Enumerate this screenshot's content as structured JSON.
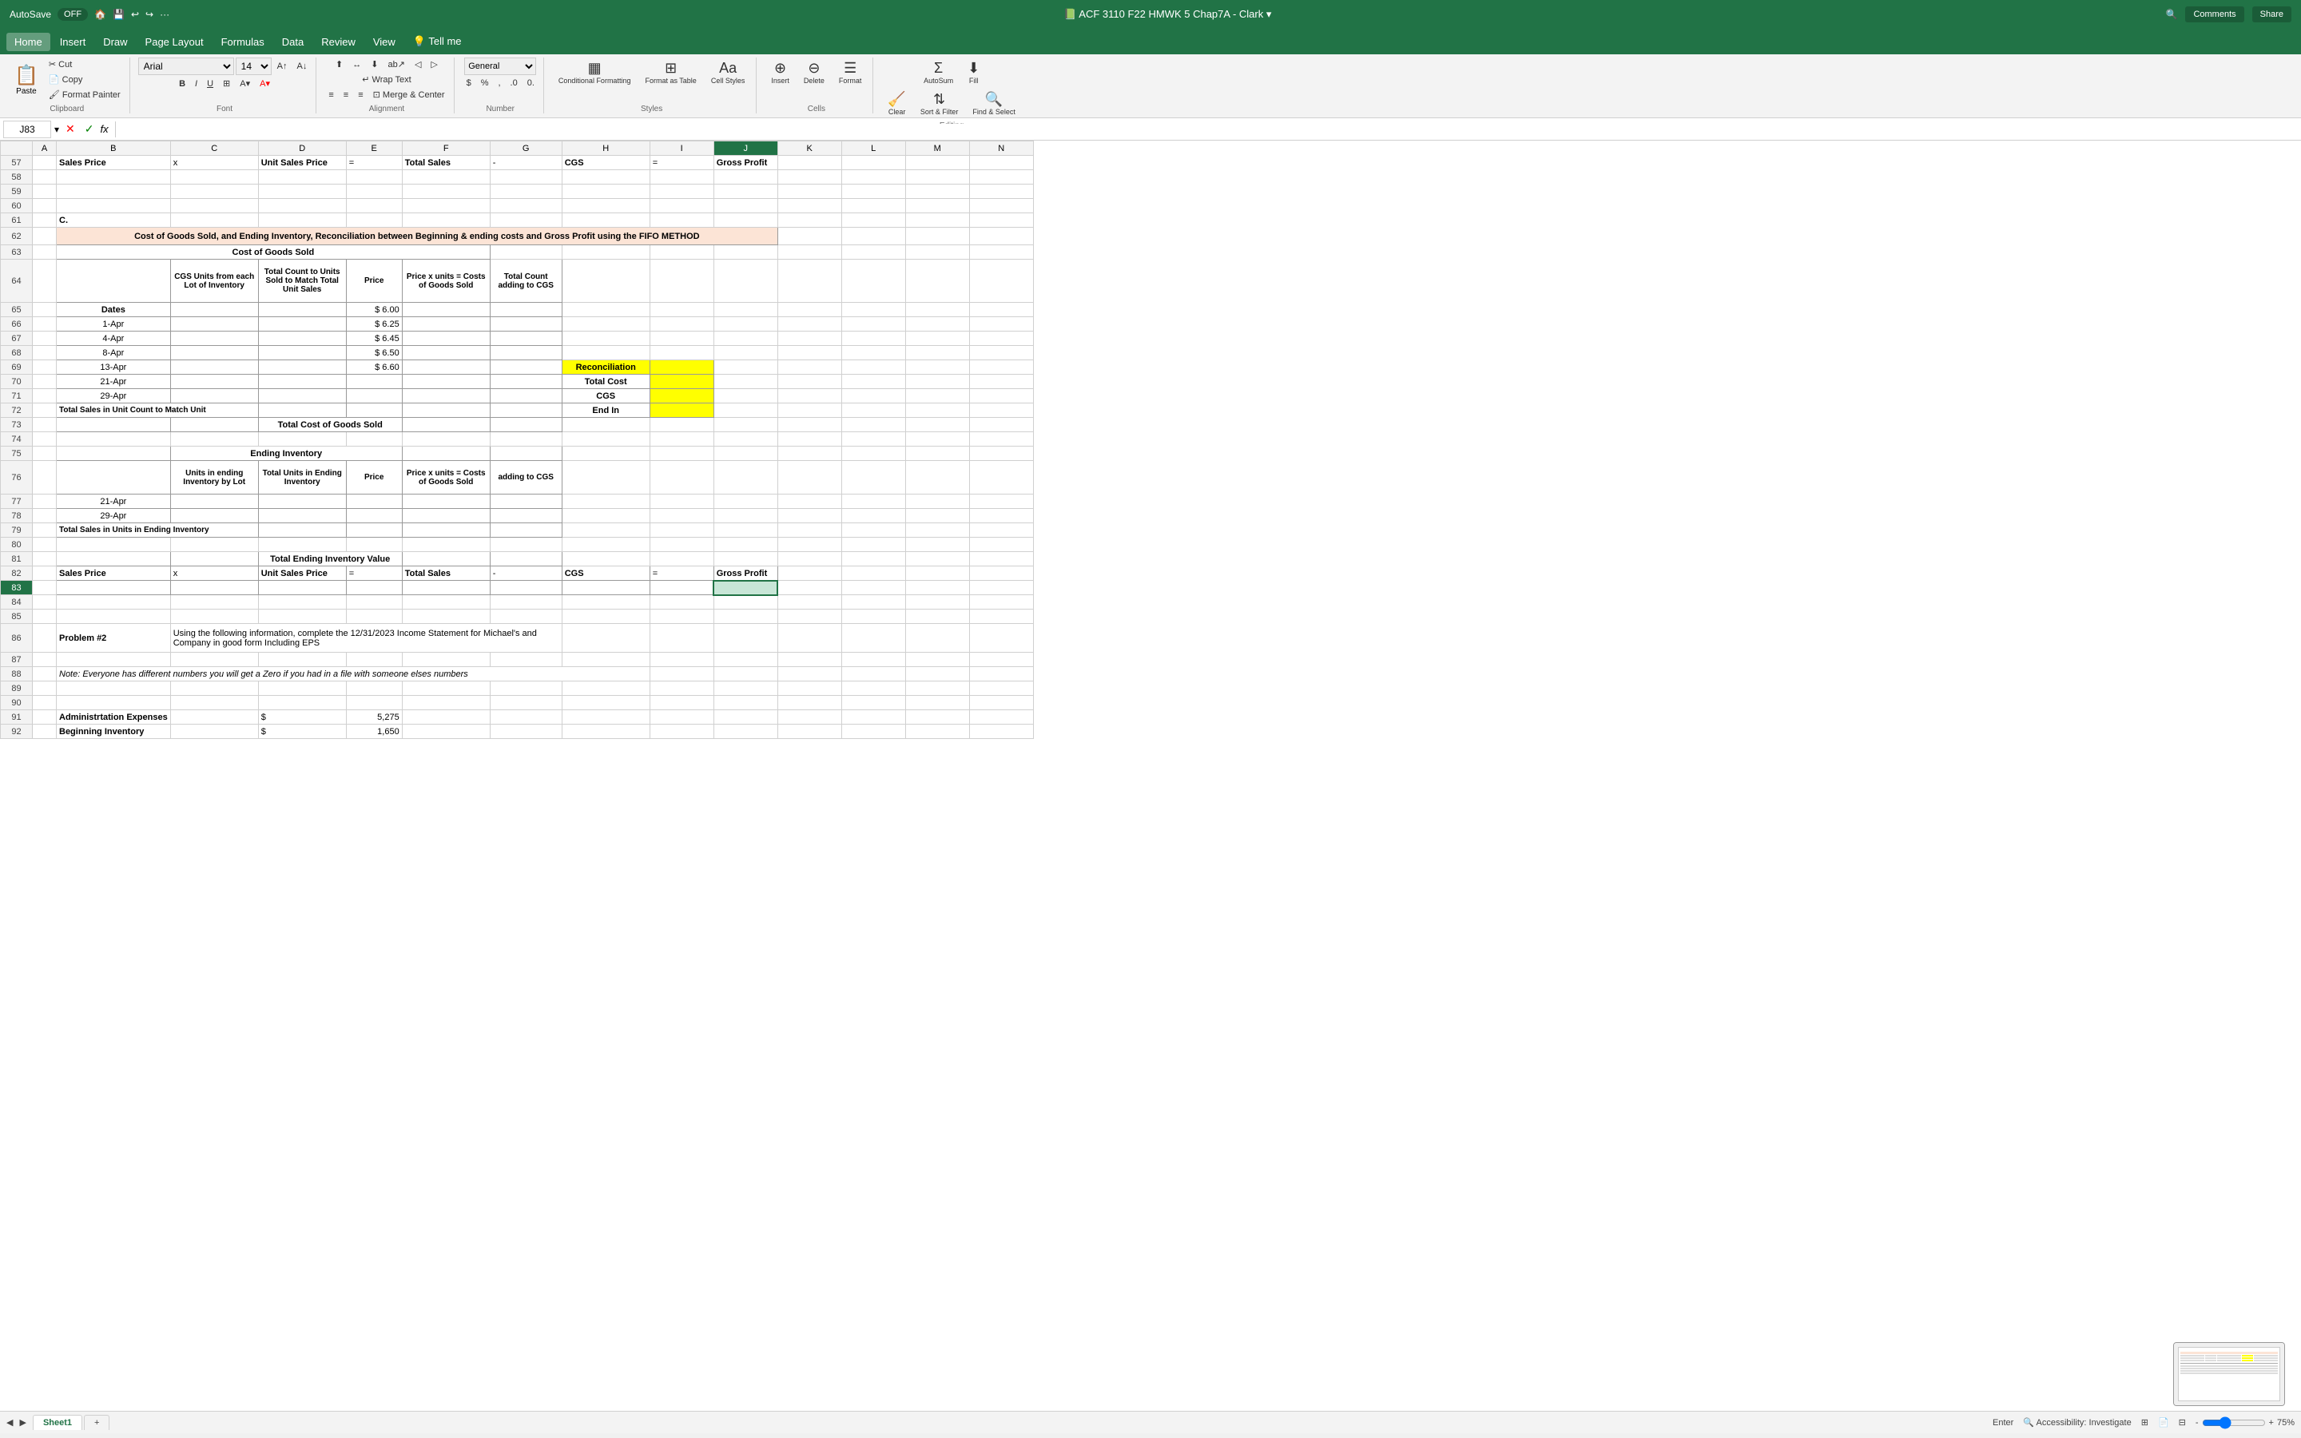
{
  "titlebar": {
    "autosave_label": "AutoSave",
    "autosave_state": "OFF",
    "filename": "ACF 3110 F22 HMWK 5 Chap7A - Clark",
    "search_icon": "🔍",
    "share_label": "Share",
    "comments_label": "Comments"
  },
  "menubar": {
    "items": [
      "Home",
      "Insert",
      "Draw",
      "Page Layout",
      "Formulas",
      "Data",
      "Review",
      "View",
      "Tell me"
    ]
  },
  "ribbon": {
    "groups": [
      {
        "name": "clipboard",
        "label": "Clipboard"
      },
      {
        "name": "font",
        "label": "Font"
      },
      {
        "name": "alignment",
        "label": "Alignment"
      },
      {
        "name": "number",
        "label": "Number"
      },
      {
        "name": "styles",
        "label": "Styles"
      },
      {
        "name": "cells",
        "label": "Cells"
      },
      {
        "name": "editing",
        "label": "Editing"
      }
    ],
    "font_name": "Arial",
    "font_size": "14",
    "wrap_text_label": "Wrap Text",
    "merge_center_label": "Merge & Center",
    "format_as_table_label": "Format as Table",
    "cell_styles_label": "Cell Styles",
    "autosum_label": "AutoSum",
    "fill_label": "Fill",
    "clear_label": "Clear",
    "sort_filter_label": "Sort & Filter",
    "find_select_label": "Find & Select",
    "conditional_formatting_label": "Conditional Formatting",
    "format_label": "Format",
    "insert_label": "Insert",
    "delete_label": "Delete"
  },
  "formulabar": {
    "cell_ref": "J83",
    "formula": ""
  },
  "sheet": {
    "active_tab": "Sheet1",
    "tabs": [
      "Sheet1"
    ]
  },
  "statusbar": {
    "mode": "Enter",
    "accessibility": "Accessibility: Investigate",
    "zoom": "75%"
  },
  "columns": [
    "A",
    "B",
    "C",
    "D",
    "E",
    "F",
    "G",
    "H",
    "I",
    "J",
    "K",
    "L",
    "M",
    "N"
  ],
  "rows": [
    {
      "num": 57,
      "cells": [
        {
          "col": "a",
          "val": ""
        },
        {
          "col": "b",
          "val": "Sales Price",
          "bold": true
        },
        {
          "col": "c",
          "val": "x"
        },
        {
          "col": "d",
          "val": "Unit Sales Price",
          "bold": true
        },
        {
          "col": "e",
          "val": "="
        },
        {
          "col": "f",
          "val": "Total Sales",
          "bold": true
        },
        {
          "col": "g",
          "val": "-"
        },
        {
          "col": "h",
          "val": "CGS",
          "bold": true
        },
        {
          "col": "i",
          "val": "="
        },
        {
          "col": "j",
          "val": "Gross Profit",
          "bold": true
        }
      ]
    },
    {
      "num": 58,
      "cells": []
    },
    {
      "num": 59,
      "cells": []
    },
    {
      "num": 60,
      "cells": []
    },
    {
      "num": 61,
      "cells": [
        {
          "col": "b",
          "val": "C.",
          "bold": true
        }
      ]
    },
    {
      "num": 62,
      "cells": [
        {
          "col": "b",
          "val": "Cost of Goods Sold, and Ending Inventory, Reconciliation between Beginning & ending costs and Gross Profit using the FIFO METHOD",
          "bold": true,
          "bg": "orange",
          "colspan": 9
        }
      ]
    },
    {
      "num": 63,
      "cells": [
        {
          "col": "b",
          "val": "Cost of Goods Sold",
          "colspan": 5,
          "center": true,
          "bold": true
        }
      ]
    },
    {
      "num": 64,
      "cells": [
        {
          "col": "b",
          "val": ""
        },
        {
          "col": "c",
          "val": "CGS Units from each Lot of Inventory",
          "bold": true,
          "center": true,
          "wrap": true
        },
        {
          "col": "d",
          "val": "Total Count to Units Sold to Match Total Unit Sales",
          "bold": true,
          "center": true,
          "wrap": true
        },
        {
          "col": "e",
          "val": "Price",
          "bold": true,
          "center": true
        },
        {
          "col": "f",
          "val": "Price x units = Costs of Goods Sold",
          "bold": true,
          "center": true,
          "wrap": true
        },
        {
          "col": "g",
          "val": "Total Count adding to CGS",
          "bold": true,
          "center": true,
          "wrap": true
        }
      ]
    },
    {
      "num": 65,
      "cells": [
        {
          "col": "b",
          "val": "Dates",
          "bold": true,
          "center": true
        },
        {
          "col": "e",
          "val": "$ 6.00",
          "right": true
        }
      ]
    },
    {
      "num": 66,
      "cells": [
        {
          "col": "b",
          "val": "1-Apr",
          "center": true
        },
        {
          "col": "e",
          "val": "$ 6.25",
          "right": true
        }
      ]
    },
    {
      "num": 67,
      "cells": [
        {
          "col": "b",
          "val": "4-Apr",
          "center": true
        },
        {
          "col": "e",
          "val": "$ 6.45",
          "right": true
        }
      ]
    },
    {
      "num": 68,
      "cells": [
        {
          "col": "b",
          "val": "8-Apr",
          "center": true
        },
        {
          "col": "e",
          "val": "$ 6.50",
          "right": true
        }
      ]
    },
    {
      "num": 69,
      "cells": [
        {
          "col": "b",
          "val": "13-Apr",
          "center": true
        },
        {
          "col": "e",
          "val": "$ 6.60",
          "right": true
        },
        {
          "col": "h",
          "val": "Reconciliation",
          "bold": true,
          "center": true,
          "bg": "yellow"
        },
        {
          "col": "i",
          "val": "",
          "bg": "yellow"
        }
      ]
    },
    {
      "num": 70,
      "cells": [
        {
          "col": "b",
          "val": "21-Apr",
          "center": true
        },
        {
          "col": "h",
          "val": "Total Cost",
          "bold": true,
          "center": true
        },
        {
          "col": "i",
          "val": "",
          "bg": "yellow"
        }
      ]
    },
    {
      "num": 71,
      "cells": [
        {
          "col": "b",
          "val": "29-Apr",
          "center": true
        },
        {
          "col": "h",
          "val": "CGS",
          "bold": true,
          "center": true
        },
        {
          "col": "i",
          "val": "",
          "bg": "yellow"
        }
      ]
    },
    {
      "num": 72,
      "cells": [
        {
          "col": "b",
          "val": "Total Sales in Unit Count to Match Unit",
          "bold": true
        },
        {
          "col": "h",
          "val": "End In",
          "bold": true,
          "center": true
        },
        {
          "col": "i",
          "val": "",
          "bg": "yellow"
        }
      ]
    },
    {
      "num": 73,
      "cells": [
        {
          "col": "d",
          "val": "Total Cost of Goods Sold",
          "bold": true,
          "center": true
        }
      ]
    },
    {
      "num": 74,
      "cells": []
    },
    {
      "num": 75,
      "cells": [
        {
          "col": "c",
          "val": "Ending Inventory",
          "bold": true,
          "center": true,
          "colspan": 3
        }
      ]
    },
    {
      "num": 76,
      "cells": [
        {
          "col": "c",
          "val": "Units in ending Inventory by Lot",
          "bold": true,
          "center": true
        },
        {
          "col": "d",
          "val": "Total Units in Ending Inventory",
          "bold": true,
          "center": true
        },
        {
          "col": "e",
          "val": "Price",
          "bold": true,
          "center": true
        },
        {
          "col": "f",
          "val": "Price x units = Costs of Goods Sold",
          "bold": true,
          "center": true
        },
        {
          "col": "g",
          "val": "adding to CGS",
          "bold": true,
          "center": true
        }
      ]
    },
    {
      "num": 77,
      "cells": [
        {
          "col": "b",
          "val": "21-Apr",
          "center": true
        }
      ]
    },
    {
      "num": 78,
      "cells": [
        {
          "col": "b",
          "val": "29-Apr",
          "center": true
        }
      ]
    },
    {
      "num": 79,
      "cells": [
        {
          "col": "b",
          "val": "Total Sales in Units in Ending Inventory",
          "bold": true
        }
      ]
    },
    {
      "num": 80,
      "cells": []
    },
    {
      "num": 81,
      "cells": [
        {
          "col": "d",
          "val": "Total Ending Inventory Value",
          "bold": true,
          "center": true
        }
      ]
    },
    {
      "num": 82,
      "cells": [
        {
          "col": "b",
          "val": "Sales Price",
          "bold": true
        },
        {
          "col": "c",
          "val": "x"
        },
        {
          "col": "d",
          "val": "Unit Sales Price",
          "bold": true
        },
        {
          "col": "e",
          "val": "="
        },
        {
          "col": "f",
          "val": "Total Sales",
          "bold": true
        },
        {
          "col": "g",
          "val": "-"
        },
        {
          "col": "h",
          "val": "CGS",
          "bold": true
        },
        {
          "col": "i",
          "val": "="
        },
        {
          "col": "j",
          "val": "Gross Profit",
          "bold": true
        }
      ]
    },
    {
      "num": 83,
      "cells": []
    },
    {
      "num": 84,
      "cells": []
    },
    {
      "num": 85,
      "cells": []
    },
    {
      "num": 86,
      "cells": [
        {
          "col": "b",
          "val": "Problem #2",
          "bold": true
        },
        {
          "col": "c",
          "val": "Using the following information, complete the 12/31/2023 Income Statement for Michael's and Company in good form  Including EPS",
          "colspan": 5
        }
      ]
    },
    {
      "num": 87,
      "cells": []
    },
    {
      "num": 88,
      "cells": [
        {
          "col": "b",
          "val": "Note: Everyone has different numbers you will get a Zero if you had in a file with someone elses numbers",
          "colspan": 7,
          "italic": true
        }
      ]
    },
    {
      "num": 89,
      "cells": []
    },
    {
      "num": 90,
      "cells": []
    },
    {
      "num": 91,
      "cells": [
        {
          "col": "b",
          "val": "Administrtation Expenses",
          "bold": true
        },
        {
          "col": "d",
          "val": "$"
        },
        {
          "col": "e",
          "val": "5,275",
          "right": true
        }
      ]
    },
    {
      "num": 92,
      "cells": [
        {
          "col": "b",
          "val": "Beginning Inventory",
          "bold": true
        },
        {
          "col": "d",
          "val": "$"
        },
        {
          "col": "e",
          "val": "1,650",
          "right": true
        }
      ]
    }
  ]
}
